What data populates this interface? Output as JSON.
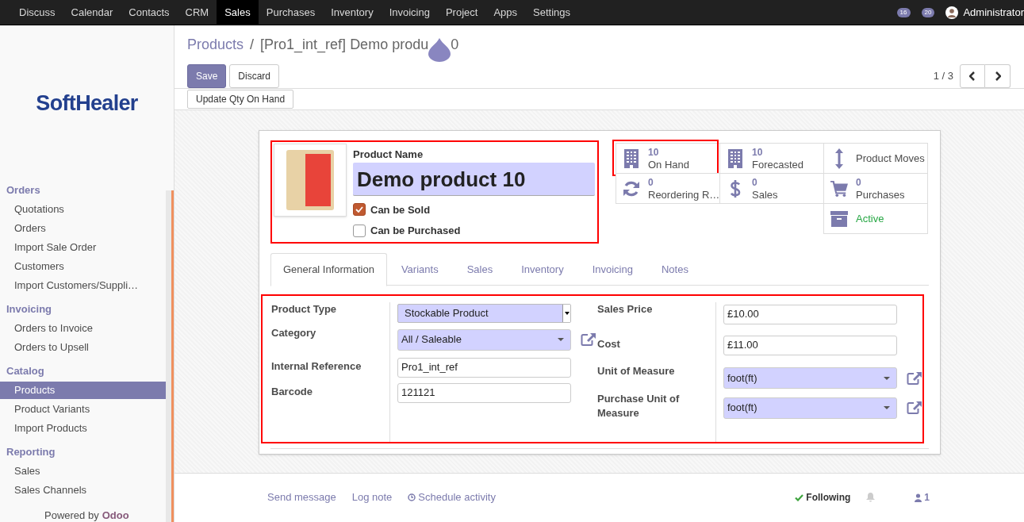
{
  "top_menu": [
    {
      "label": "Discuss",
      "selected": false
    },
    {
      "label": "Calendar",
      "selected": false
    },
    {
      "label": "Contacts",
      "selected": false
    },
    {
      "label": "CRM",
      "selected": false
    },
    {
      "label": "Sales",
      "selected": true
    },
    {
      "label": "Purchases",
      "selected": false
    },
    {
      "label": "Inventory",
      "selected": false
    },
    {
      "label": "Invoicing",
      "selected": false
    },
    {
      "label": "Project",
      "selected": false
    },
    {
      "label": "Apps",
      "selected": false
    },
    {
      "label": "Settings",
      "selected": false
    }
  ],
  "systray": {
    "activities_count": "16",
    "messages_count": "20",
    "user": "Administrator"
  },
  "logo": {
    "text": "SoftHealer"
  },
  "sidebar": {
    "sections": [
      {
        "title": "Orders",
        "items": [
          {
            "label": "Quotations",
            "selected": false
          },
          {
            "label": "Orders",
            "selected": false
          },
          {
            "label": "Import Sale Order",
            "selected": false
          },
          {
            "label": "Customers",
            "selected": false
          },
          {
            "label": "Import Customers/Suppli…",
            "selected": false
          }
        ]
      },
      {
        "title": "Invoicing",
        "items": [
          {
            "label": "Orders to Invoice",
            "selected": false
          },
          {
            "label": "Orders to Upsell",
            "selected": false
          }
        ]
      },
      {
        "title": "Catalog",
        "items": [
          {
            "label": "Products",
            "selected": true
          },
          {
            "label": "Product Variants",
            "selected": false
          },
          {
            "label": "Import Products",
            "selected": false
          }
        ]
      },
      {
        "title": "Reporting",
        "items": [
          {
            "label": "Sales",
            "selected": false
          },
          {
            "label": "Sales Channels",
            "selected": false
          }
        ]
      }
    ],
    "footer": {
      "prefix": "Powered by",
      "brand": "Odoo"
    }
  },
  "breadcrumb": {
    "parent": "Products",
    "separator": "/",
    "current_parts": [
      "[Pro1_int_ref] Demo produ",
      "0"
    ]
  },
  "buttons": [
    {
      "label": "Save",
      "kind": "primary"
    },
    {
      "label": "Discard",
      "kind": "secondary"
    }
  ],
  "pager": {
    "value": "1 / 3"
  },
  "header_buttons": [
    "Update Qty On Hand"
  ],
  "product": {
    "highlighted": true,
    "name_label": "Product Name",
    "name": "Demo product 10",
    "options": [
      {
        "label": "Can be Sold",
        "checked": true
      },
      {
        "label": "Can be Purchased",
        "checked": false
      }
    ]
  },
  "smart_buttons": [
    {
      "kind": "stat",
      "value": "10",
      "label": "On Hand",
      "highlighted": true
    },
    {
      "kind": "stat",
      "value": "10",
      "label": "Forecasted",
      "highlighted": false
    },
    {
      "kind": "plain",
      "label": "Product Moves",
      "highlighted": false
    },
    {
      "kind": "stat",
      "value": "0",
      "label": "Reordering R…",
      "highlighted": false
    },
    {
      "kind": "stat",
      "value": "0",
      "label": "Sales",
      "highlighted": false
    },
    {
      "kind": "stat",
      "value": "0",
      "label": "Purchases",
      "highlighted": false
    },
    {
      "kind": "toggle",
      "label": "Active",
      "highlighted": false
    }
  ],
  "tabs": [
    {
      "label": "General Information",
      "selected": true
    },
    {
      "label": "Variants",
      "selected": false
    },
    {
      "label": "Sales",
      "selected": false
    },
    {
      "label": "Inventory",
      "selected": false
    },
    {
      "label": "Invoicing",
      "selected": false
    },
    {
      "label": "Notes",
      "selected": false
    }
  ],
  "general_info": {
    "highlighted": true,
    "left": [
      {
        "label": "Product Type",
        "value": "Stockable Product",
        "kind": "native_select",
        "link": false
      },
      {
        "label": "Category",
        "value": "All / Saleable",
        "kind": "select",
        "link": true
      },
      {
        "label": "Internal Reference",
        "value": "Pro1_int_ref",
        "kind": "input",
        "link": false
      },
      {
        "label": "Barcode",
        "value": "121121",
        "kind": "input",
        "link": false
      }
    ],
    "right": [
      {
        "label": "Sales Price",
        "value": "£10.00",
        "kind": "input",
        "link": false
      },
      {
        "label": "Cost",
        "value": "£11.00",
        "kind": "input",
        "link": false
      },
      {
        "label": "Unit of Measure",
        "value": "foot(ft)",
        "kind": "select",
        "link": true
      },
      {
        "label": "Purchase Unit of Measure",
        "value": "foot(ft)",
        "kind": "select",
        "link": true
      }
    ]
  },
  "chatter": {
    "actions": [
      "Send message",
      "Log note",
      "Schedule activity"
    ],
    "following": "Following",
    "followers_count": "1"
  }
}
